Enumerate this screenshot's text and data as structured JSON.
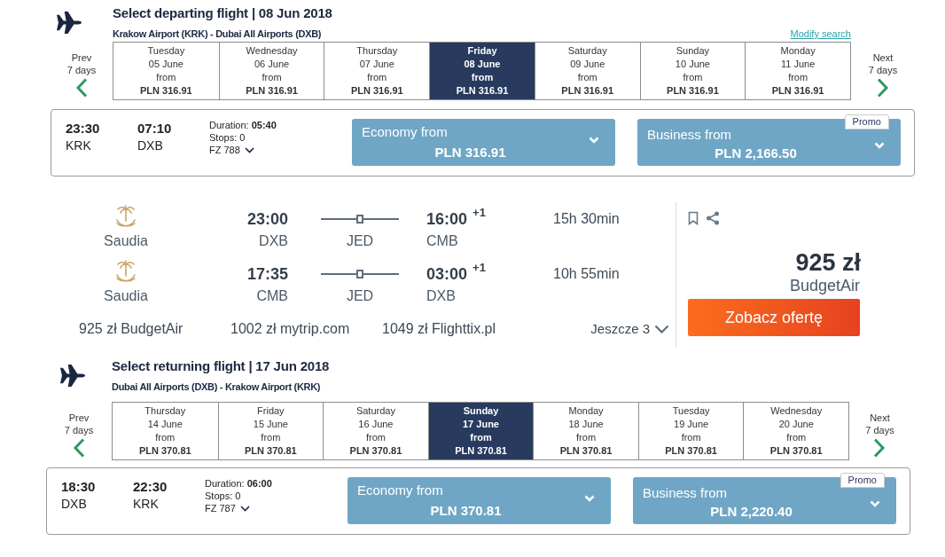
{
  "departing_flight": {
    "title": "Select departing flight | 08 Jun 2018",
    "route": "Krakow Airport (KRK) - Dubai All Airports (DXB)",
    "modify_link": "Modify search",
    "prev": [
      "Prev",
      "7 days"
    ],
    "next": [
      "Next",
      "7 days"
    ],
    "days": [
      {
        "day": "Tuesday",
        "date": "05 June",
        "from": "from",
        "price": "PLN 316.91",
        "selected": false
      },
      {
        "day": "Wednesday",
        "date": "06 June",
        "from": "from",
        "price": "PLN 316.91",
        "selected": false
      },
      {
        "day": "Thursday",
        "date": "07 June",
        "from": "from",
        "price": "PLN 316.91",
        "selected": false
      },
      {
        "day": "Friday",
        "date": "08 June",
        "from": "from",
        "price": "PLN 316.91",
        "selected": true
      },
      {
        "day": "Saturday",
        "date": "09 June",
        "from": "from",
        "price": "PLN 316.91",
        "selected": false
      },
      {
        "day": "Sunday",
        "date": "10 June",
        "from": "from",
        "price": "PLN 316.91",
        "selected": false
      },
      {
        "day": "Monday",
        "date": "11 June",
        "from": "from",
        "price": "PLN 316.91",
        "selected": false
      }
    ],
    "flight": {
      "depart_time": "23:30",
      "depart_airport": "KRK",
      "arrive_time": "07:10",
      "arrive_airport": "DXB",
      "duration": "Duration: **05:40**",
      "stops": "Stops: 0",
      "flight_number": "FZ 788"
    },
    "fares": [
      {
        "label": "Economy from",
        "price": "PLN 316.91"
      },
      {
        "label": "Business from",
        "price": "PLN 2,166.50",
        "badge": "Promo"
      }
    ]
  },
  "offer_ad": {
    "legs": [
      {
        "airline": "Saudia",
        "depart_time": "23:00",
        "depart_airport": "DXB",
        "stop_airport": "JED",
        "arrive_time": "16:00",
        "day_offset": "+1",
        "arrive_airport": "CMB",
        "duration": "15h 30min"
      },
      {
        "airline": "Saudia",
        "depart_time": "17:35",
        "depart_airport": "CMB",
        "stop_airport": "JED",
        "arrive_time": "03:00",
        "day_offset": "+1",
        "arrive_airport": "DXB",
        "duration": "10h 55min"
      }
    ],
    "other_offers": [
      "925 zł BudgetAir",
      "1002 zł mytrip.com",
      "1049 zł Flighttix.pl"
    ],
    "more_offers": "Jeszcze 3",
    "price": "925 zł",
    "provider": "BudgetAir",
    "cta": "Zobacz ofertę"
  },
  "returning_flight": {
    "title": "Select returning flight | 17 Jun 2018",
    "route": "Dubai All Airports (DXB) - Krakow Airport (KRK)",
    "prev": [
      "Prev",
      "7 days"
    ],
    "next": [
      "Next",
      "7 days"
    ],
    "days": [
      {
        "day": "Thursday",
        "date": "14 June",
        "from": "from",
        "price": "PLN 370.81",
        "selected": false
      },
      {
        "day": "Friday",
        "date": "15 June",
        "from": "from",
        "price": "PLN 370.81",
        "selected": false
      },
      {
        "day": "Saturday",
        "date": "16 June",
        "from": "from",
        "price": "PLN 370.81",
        "selected": false
      },
      {
        "day": "Sunday",
        "date": "17 June",
        "from": "from",
        "price": "PLN 370.81",
        "selected": true
      },
      {
        "day": "Monday",
        "date": "18 June",
        "from": "from",
        "price": "PLN 370.81",
        "selected": false
      },
      {
        "day": "Tuesday",
        "date": "19 June",
        "from": "from",
        "price": "PLN 370.81",
        "selected": false
      },
      {
        "day": "Wednesday",
        "date": "20 June",
        "from": "from",
        "price": "PLN 370.81",
        "selected": false
      }
    ],
    "flight": {
      "depart_time": "18:30",
      "depart_airport": "DXB",
      "arrive_time": "22:30",
      "arrive_airport": "KRK",
      "duration": "Duration: **06:00**",
      "stops": "Stops: 0",
      "flight_number": "FZ 787"
    },
    "fares": [
      {
        "label": "Economy from",
        "price": "PLN 370.81"
      },
      {
        "label": "Business from",
        "price": "PLN 2,220.40",
        "badge": "Promo"
      }
    ]
  }
}
